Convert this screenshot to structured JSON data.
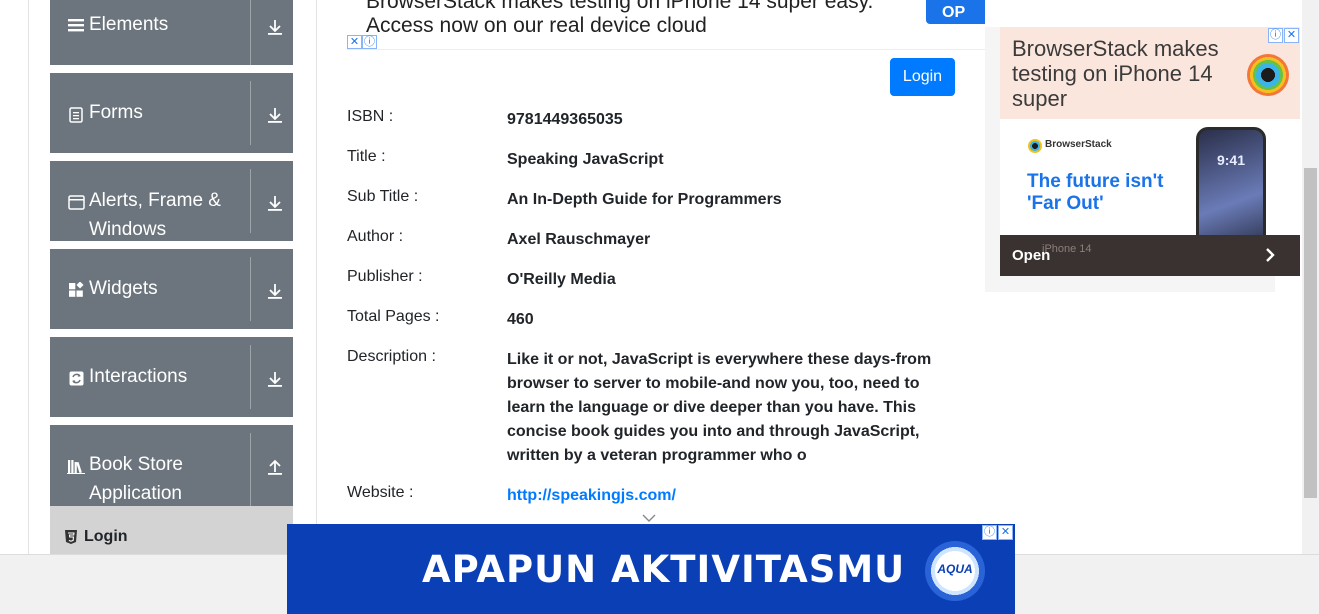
{
  "sidebar": {
    "groups": [
      {
        "label": "Elements",
        "icon": "hamburger-icon",
        "toggle": "download-arrow-icon"
      },
      {
        "label": "Forms",
        "icon": "form-icon",
        "toggle": "download-arrow-icon"
      },
      {
        "label": "Alerts, Frame & Windows",
        "icon": "window-icon",
        "toggle": "download-arrow-icon"
      },
      {
        "label": "Widgets",
        "icon": "widgets-icon",
        "toggle": "download-arrow-icon"
      },
      {
        "label": "Interactions",
        "icon": "interactions-icon",
        "toggle": "download-arrow-icon"
      },
      {
        "label": "Book Store Application",
        "icon": "books-icon",
        "toggle": "upload-arrow-icon"
      }
    ],
    "active_item": {
      "label": "Login",
      "icon": "html-shield-icon"
    }
  },
  "top_ad": {
    "line1": "BrowserStack makes testing on iPhone 14 super easy.",
    "line2": "Access now on our real device cloud",
    "cta": "OP"
  },
  "login_button": "Login",
  "book": [
    {
      "label": "ISBN :",
      "value": "9781449365035"
    },
    {
      "label": "Title :",
      "value": "Speaking JavaScript"
    },
    {
      "label": "Sub Title :",
      "value": "An In-Depth Guide for Programmers"
    },
    {
      "label": "Author :",
      "value": "Axel Rauschmayer"
    },
    {
      "label": "Publisher :",
      "value": "O'Reilly Media"
    },
    {
      "label": "Total Pages :",
      "value": "460"
    },
    {
      "label": "Description :",
      "value": "Like it or not, JavaScript is everywhere these days-from browser to server to mobile-and now you, too, need to learn the language or dive deeper than you have. This concise book guides you into and through JavaScript, written by a veteran programmer who o"
    },
    {
      "label": "Website :",
      "value": "http://speakingjs.com/"
    }
  ],
  "right_ad": {
    "headline": "BrowserStack makes testing on iPhone 14 super",
    "brand": "BrowserStack",
    "tagline": "The future isn't 'Far Out'",
    "phone_time": "9:41",
    "open": "Open",
    "caption": "iPhone 14"
  },
  "bottom_ad": {
    "text": "APAPUN AKTIVITASMU",
    "logo": "AQUA"
  },
  "colors": {
    "sidebar_group": "#6c757d",
    "primary": "#007bff",
    "submenu_active": "#d3d3d3",
    "bottom_ad_bg": "#0b3fb5"
  }
}
